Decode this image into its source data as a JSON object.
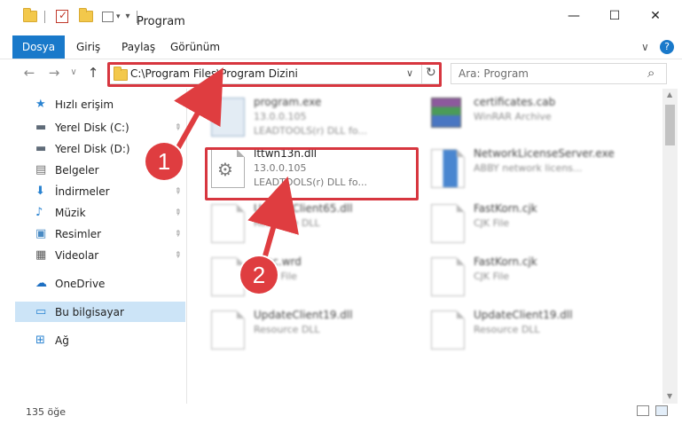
{
  "window": {
    "title": "Program",
    "controls": {
      "minimize": "—",
      "maximize": "☐",
      "close": "✕"
    }
  },
  "ribbon": {
    "tabs": [
      "Dosya",
      "Giriş",
      "Paylaş",
      "Görünüm"
    ],
    "collapse": "∨",
    "help": "?"
  },
  "navigation": {
    "back": "←",
    "forward": "→",
    "recent": "∨",
    "up": "↑",
    "address": "C:\\Program Files\\Program Dizini",
    "address_dropdown": "∨",
    "refresh": "↻",
    "search_placeholder": "Ara: Program",
    "search_icon": "⌕"
  },
  "sidebar": {
    "items": [
      {
        "label": "Hızlı erişim",
        "icon": "star-icon",
        "glyph": "★",
        "color": "#2a83d1"
      },
      {
        "label": "Yerel Disk (C:)",
        "icon": "drive-icon",
        "glyph": "▬",
        "color": "#5f6b78",
        "pinned": true
      },
      {
        "label": "Yerel Disk (D:)",
        "icon": "drive-icon",
        "glyph": "▬",
        "color": "#5f6b78",
        "pinned": true
      },
      {
        "label": "Belgeler",
        "icon": "documents-icon",
        "glyph": "▤",
        "color": "#707070",
        "pinned": true
      },
      {
        "label": "İndirmeler",
        "icon": "downloads-icon",
        "glyph": "⬇",
        "color": "#2a83d1",
        "pinned": true
      },
      {
        "label": "Müzik",
        "icon": "music-icon",
        "glyph": "♪",
        "color": "#2a83d1",
        "pinned": true
      },
      {
        "label": "Resimler",
        "icon": "pictures-icon",
        "glyph": "▣",
        "color": "#4a8bc4",
        "pinned": true
      },
      {
        "label": "Videolar",
        "icon": "videos-icon",
        "glyph": "▦",
        "color": "#5a5a5a",
        "pinned": true
      },
      {
        "label": "OneDrive",
        "icon": "onedrive-icon",
        "glyph": "☁",
        "color": "#1d6fc2"
      },
      {
        "label": "Bu bilgisayar",
        "icon": "computer-icon",
        "glyph": "▭",
        "color": "#2a83d1",
        "selected": true
      },
      {
        "label": "Ağ",
        "icon": "network-icon",
        "glyph": "⊞",
        "color": "#2a83d1"
      }
    ],
    "pin_glyph": "📌"
  },
  "files": [
    {
      "name": "program.exe",
      "line2": "13.0.0.105",
      "line3": "LEADTOOLS(r) DLL fo...",
      "icon": "exe-icon",
      "blurred": true
    },
    {
      "name": "certificates.cab",
      "line2": "WinRAR Archive",
      "line3": "",
      "icon": "archive-icon",
      "blurred": true
    },
    {
      "name": "lttwn13n.dll",
      "line2": "13.0.0.105",
      "line3": "LEADTOOLS(r) DLL fo...",
      "icon": "dll-gear-icon",
      "blurred": false
    },
    {
      "name": "NetworkLicenseServer.exe",
      "line2": "ABBY network licens...",
      "line3": "",
      "icon": "exe-icon",
      "blurred": true
    },
    {
      "name": "UpdateClient65.dll",
      "line2": "Resource DLL",
      "line3": "",
      "icon": "file-icon",
      "blurred": true
    },
    {
      "name": "FastKorn.cjk",
      "line2": "CJK File",
      "line3": "",
      "icon": "file-icon",
      "blurred": true
    },
    {
      "name": "misc.wrd",
      "line2": "WRD File",
      "line3": "",
      "icon": "file-icon",
      "blurred": true
    },
    {
      "name": "FastKorn.cjk",
      "line2": "CJK File",
      "line3": "",
      "icon": "file-icon",
      "blurred": true
    },
    {
      "name": "UpdateClient19.dll",
      "line2": "Resource DLL",
      "line3": "",
      "icon": "file-icon",
      "blurred": true
    },
    {
      "name": "UpdateClient19.dll",
      "line2": "Resource DLL",
      "line3": "",
      "icon": "file-icon",
      "blurred": true
    }
  ],
  "status": {
    "count": "135 öğe"
  },
  "annotations": [
    {
      "number": "1",
      "color": "#df3d40"
    },
    {
      "number": "2",
      "color": "#df3d40"
    }
  ]
}
